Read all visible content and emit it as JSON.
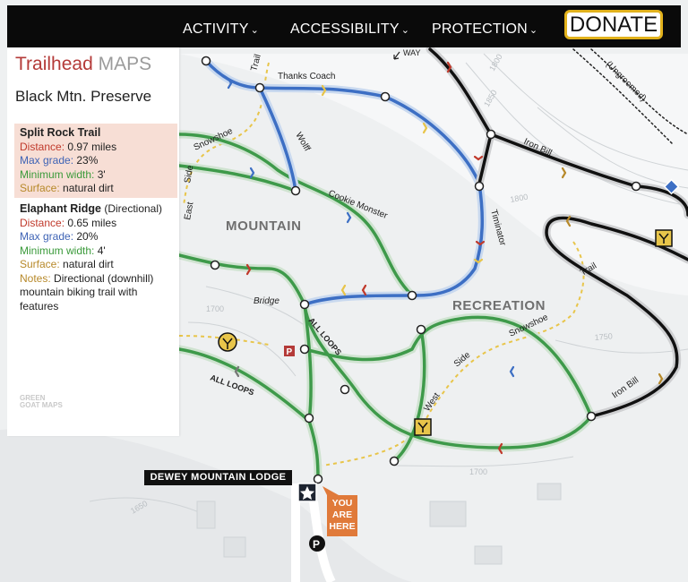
{
  "nav": {
    "items": [
      "ACTIVITY",
      "ACCESSIBILITY",
      "PROTECTION"
    ],
    "donate": "DONATE"
  },
  "panel": {
    "brand_primary": "Trailhead",
    "brand_secondary": "MAPS",
    "preserve": "Black Mtn. Preserve",
    "logo_text": "GREEN GOAT MAPS"
  },
  "trails": [
    {
      "name": "Split Rock Trail",
      "name_suffix": "",
      "distance_label": "Distance:",
      "distance": "0.97 miles",
      "grade_label": "Max grade:",
      "grade": "23%",
      "width_label": "Minimum width:",
      "width": "3'",
      "surface_label": "Surface:",
      "surface": "natural dirt"
    },
    {
      "name": "Elaphant Ridge",
      "name_suffix": "(Directional)",
      "distance_label": "Distance:",
      "distance": "0.65 miles",
      "grade_label": "Max grade:",
      "grade": "20%",
      "width_label": "Minimum width:",
      "width": "4'",
      "surface_label": "Surface:",
      "surface": "natural dirt",
      "notes_label": "Notes:",
      "notes": "Directional (downhill) mountain biking trail with features"
    }
  ],
  "map": {
    "area_labels": [
      "MOUNTAIN",
      "RECREATION"
    ],
    "trail_labels": [
      "Thanks Coach",
      "Wolff",
      "Snowshoe",
      "Cookie Monster",
      "Iron Bill",
      "Timinator",
      "Trail",
      "East",
      "Side",
      "Bridge",
      "ALL LOOPS",
      "ALL LOOPS",
      "Snowshoe",
      "Side",
      "West",
      "Iron Bill",
      "Trail",
      "(Ungroomed)",
      "WAY"
    ],
    "contours": [
      "1800",
      "1850",
      "1800",
      "1750",
      "1700",
      "1700",
      "1650"
    ],
    "lodge": "DEWEY MOUNTAIN LODGE",
    "you_are_here": "YOU ARE HERE",
    "parking": "P",
    "parking_main": "P"
  },
  "colors": {
    "blue_trail": "#3d6fc4",
    "green_trail": "#3e9a4a",
    "black_trail": "#111111",
    "accent_red": "#b43a38",
    "accent_gold": "#e2b21c"
  }
}
